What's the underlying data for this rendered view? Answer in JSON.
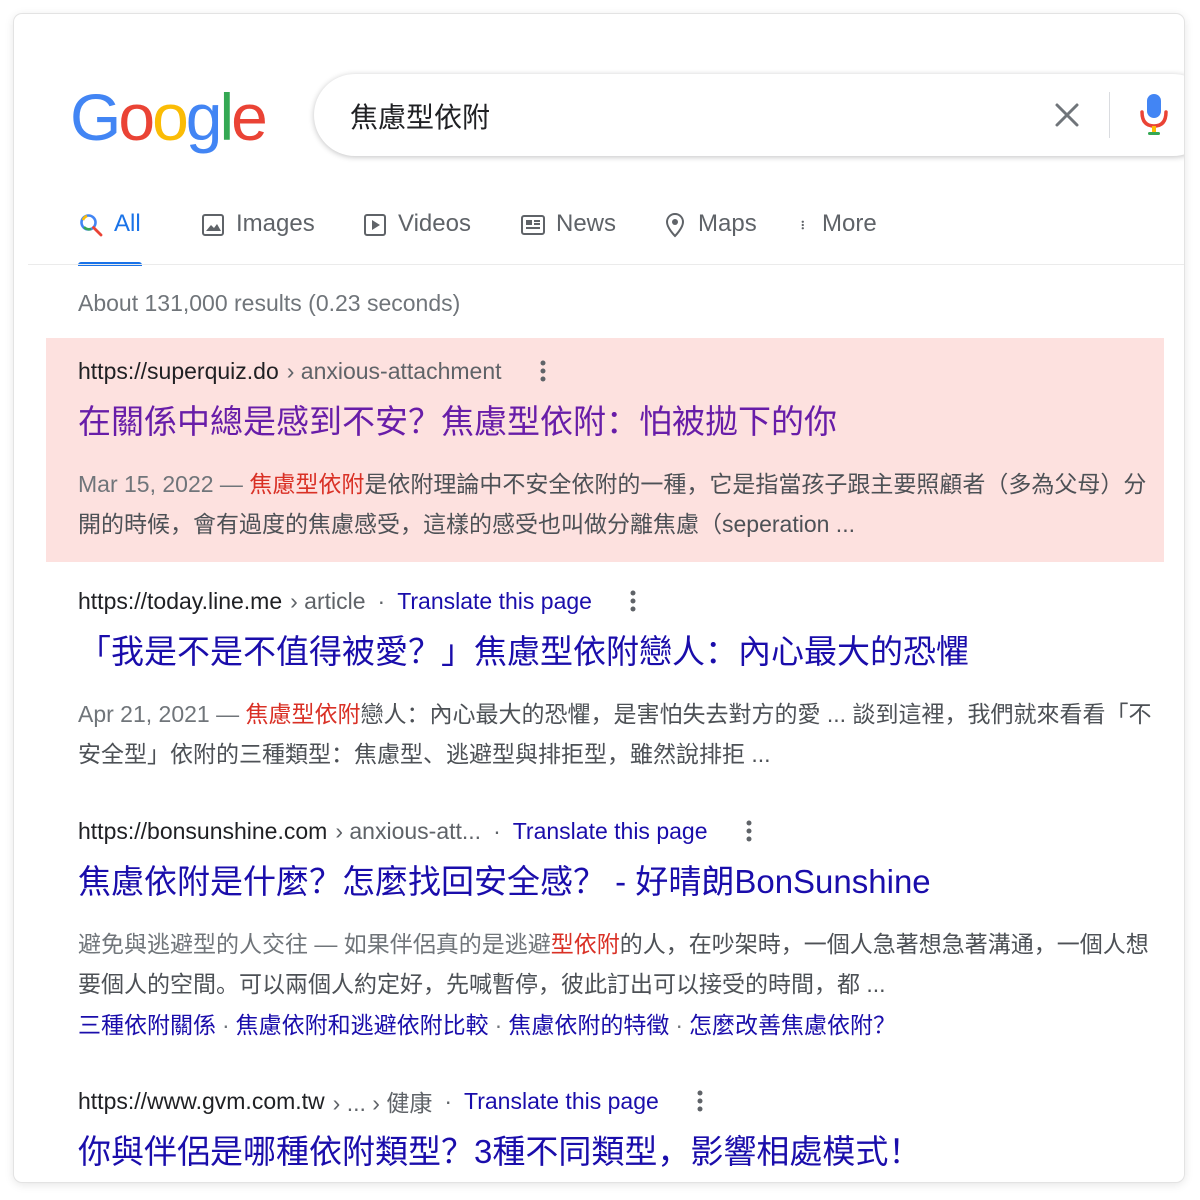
{
  "search": {
    "logo_letters": [
      {
        "ch": "G",
        "color": "#4285F4"
      },
      {
        "ch": "o",
        "color": "#EA4335"
      },
      {
        "ch": "o",
        "color": "#FBBC05"
      },
      {
        "ch": "g",
        "color": "#4285F4"
      },
      {
        "ch": "l",
        "color": "#34A853"
      },
      {
        "ch": "e",
        "color": "#EA4335"
      }
    ],
    "query": "焦慮型依附",
    "clear_icon": "close-icon",
    "mic_icon": "mic-icon"
  },
  "tabs": [
    {
      "label": "All",
      "icon": "search-icon",
      "active": true
    },
    {
      "label": "Images",
      "icon": "image-icon"
    },
    {
      "label": "Videos",
      "icon": "video-icon"
    },
    {
      "label": "News",
      "icon": "news-icon"
    },
    {
      "label": "Maps",
      "icon": "map-pin-icon"
    },
    {
      "label": "More",
      "icon": "more-vert-icon"
    }
  ],
  "stats": "About 131,000 results (0.23 seconds)",
  "results": [
    {
      "site": "https://superquiz.do",
      "path": "› anxious-attachment",
      "title": "在關係中總是感到不安？焦慮型依附：怕被拋下的你",
      "date": "Mar 15, 2022 — ",
      "snippet_em": "焦慮型依附",
      "snippet_rest": "是依附理論中不安全依附的一種，它是指當孩子跟主要照顧者（多為父母）分開的時候，會有過度的焦慮感受，這樣的感受也叫做分離焦慮（seperation ...",
      "highlighted": true
    },
    {
      "site": "https://today.line.me",
      "path": "› article",
      "translate": "Translate this page",
      "title": "「我是不是不值得被愛？」焦慮型依附戀人：內心最大的恐懼",
      "date": "Apr 21, 2021 — ",
      "snippet_em": "焦慮型依附",
      "snippet_rest": "戀人：內心最大的恐懼，是害怕失去對方的愛 ... 談到這裡，我們就來看看「不安全型」依附的三種類型：焦慮型、逃避型與排拒型，雖然說排拒 ..."
    },
    {
      "site": "https://bonsunshine.com",
      "path": "› anxious-att...",
      "translate": "Translate this page",
      "title": "焦慮依附是什麼？怎麼找回安全感？ - 好晴朗BonSunshine",
      "snippet_pre": "避免與逃避型的人交往 — 如果伴侶真的是逃避",
      "snippet_em": "型依附",
      "snippet_rest": "的人，在吵架時，一個人急著想急著溝通，一個人想要個人的空間。可以兩個人約定好，先喊暫停，彼此訂出可以接受的時間，都 ...",
      "sitelinks": [
        "三種依附關係",
        "焦慮依附和逃避依附比較",
        "焦慮依附的特徵",
        "怎麼改善焦慮依附？"
      ]
    },
    {
      "site": "https://www.gvm.com.tw",
      "path": "› ... › 健康",
      "translate": "Translate this page",
      "title": "你與伴侶是哪種依附類型？3種不同類型，影響相處模式！"
    }
  ],
  "colors": {
    "link": "#1a0dab",
    "visited": "#681da8",
    "highlight_bg": "#fde1df",
    "accent": "#1a73e8",
    "em": "#d93025"
  }
}
